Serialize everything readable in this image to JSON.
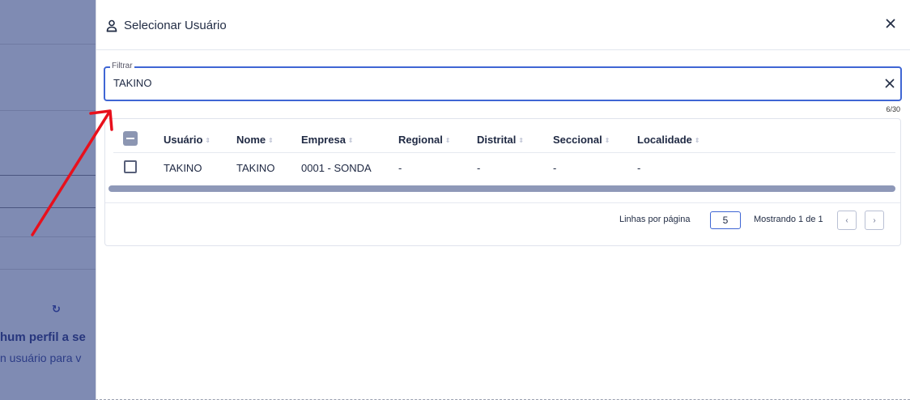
{
  "background": {
    "icon": "refresh-icon",
    "icon_glyph": "↻",
    "title": "hum perfil a se",
    "subtitle": "n usuário para v"
  },
  "modal": {
    "title": "Selecionar Usuário",
    "header_icon": "user-icon",
    "close_icon": "close-icon"
  },
  "filter": {
    "legend": "Filtrar",
    "value": "TAKINO",
    "counter": "6/30",
    "clear_icon": "close-icon"
  },
  "table": {
    "columns": [
      "Usuário",
      "Nome",
      "Empresa",
      "Regional",
      "Distrital",
      "Seccional",
      "Localidade"
    ],
    "rows": [
      {
        "usuario": "TAKINO",
        "nome": "TAKINO",
        "empresa": "0001 - SONDA",
        "regional": "-",
        "distrital": "-",
        "seccional": "-",
        "localidade": "-"
      }
    ],
    "sort_glyph": "⇕"
  },
  "pagination": {
    "rows_per_page_label": "Linhas por página",
    "rows_per_page_value": "5",
    "showing_label": "Mostrando 1 de 1",
    "prev_glyph": "‹",
    "next_glyph": "›"
  },
  "colors": {
    "accent": "#3f66d4",
    "annotation": "#e8101c",
    "overlay": "#7f8bb3"
  }
}
